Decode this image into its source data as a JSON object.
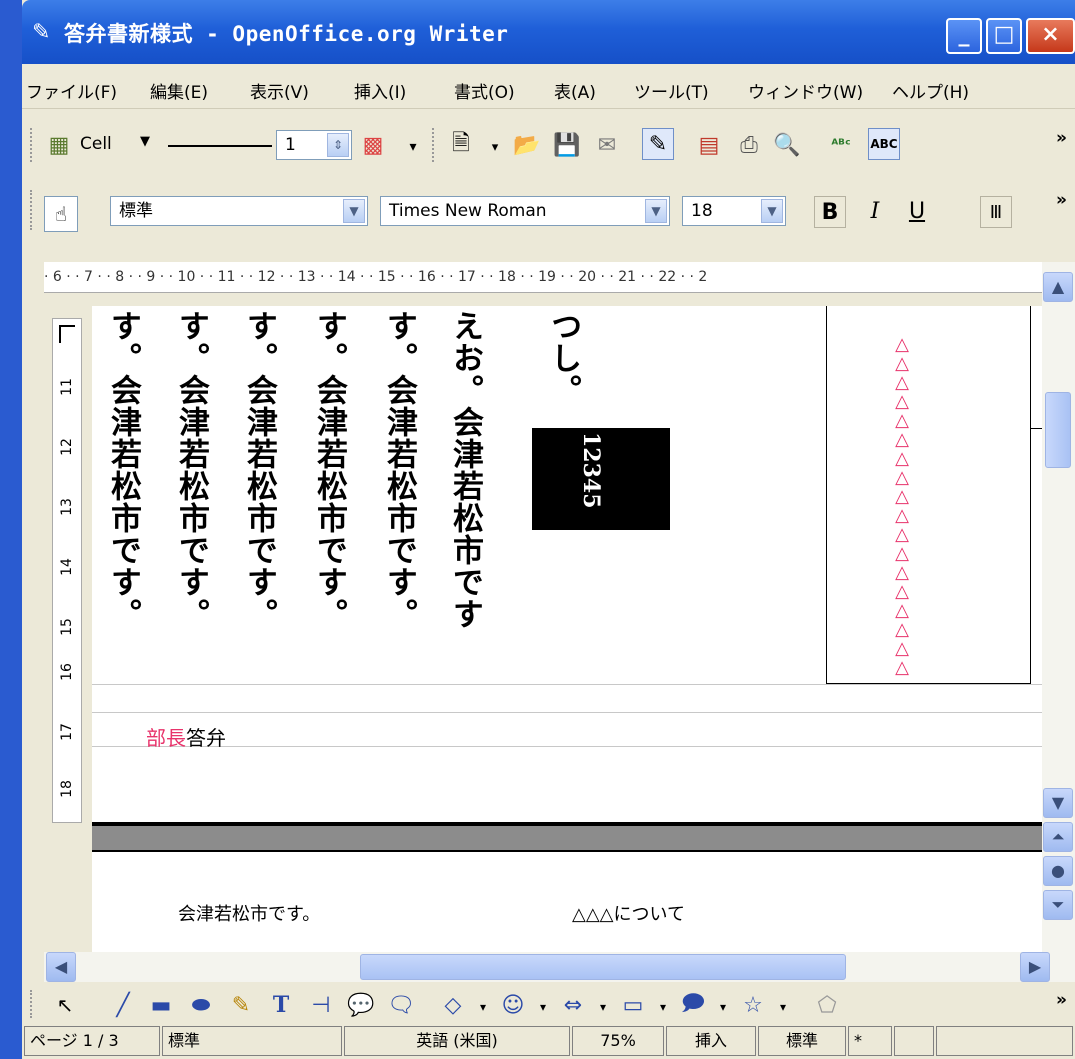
{
  "window": {
    "title": "答弁書新様式 - OpenOffice.org Writer",
    "controls": {
      "minimize": "_",
      "maximize": "□",
      "close": "×"
    }
  },
  "menu": [
    "ファイル(F)",
    "編集(E)",
    "表示(V)",
    "挿入(I)",
    "書式(O)",
    "表(A)",
    "ツール(T)",
    "ウィンドウ(W)",
    "ヘルプ(H)"
  ],
  "toolbar1": {
    "cell_label": "Cell",
    "line_width": "1",
    "overflow": "»"
  },
  "toolbar2": {
    "paragraph_style": "標準",
    "font_name": "Times New Roman",
    "font_size": "18",
    "bold": "B",
    "italic": "I",
    "underline": "U",
    "overflow": "»"
  },
  "ruler": {
    "horizontal": "· 6 · · 7 · · 8 · · 9 · · 10 · · 11 · · 12 · · 13 · · 14 · · 15 · · 16 · · 17 · · 18 · · 19 · · 20 · · 21 · · 22 · · 2",
    "vertical": [
      "11",
      "12",
      "13",
      "14",
      "15",
      "16",
      "17",
      "18"
    ]
  },
  "document": {
    "columns": [
      "す。会津若松市です。",
      "す。会津若松市です。",
      "す。会津若松市です。",
      "す。会津若松市です。",
      "す。会津若松市です。",
      "えお。会津若松市です",
      "つし。"
    ],
    "black_box_text": "12345",
    "triangles": "△△△△△△△△△△△△△△△△△△",
    "answer_label_red": "部長",
    "answer_label_black": "答弁",
    "bottom_text_left": "会津若松市です。",
    "bottom_text_right": "△△△について"
  },
  "statusbar": {
    "page": "ページ 1 / 3",
    "style": "標準",
    "language": "英語 (米国)",
    "zoom": "75%",
    "mode": "挿入",
    "selection": "標準",
    "modified": "*"
  },
  "colors": {
    "accent_red": "#e8336b",
    "title_blue": "#1f5fd8"
  }
}
